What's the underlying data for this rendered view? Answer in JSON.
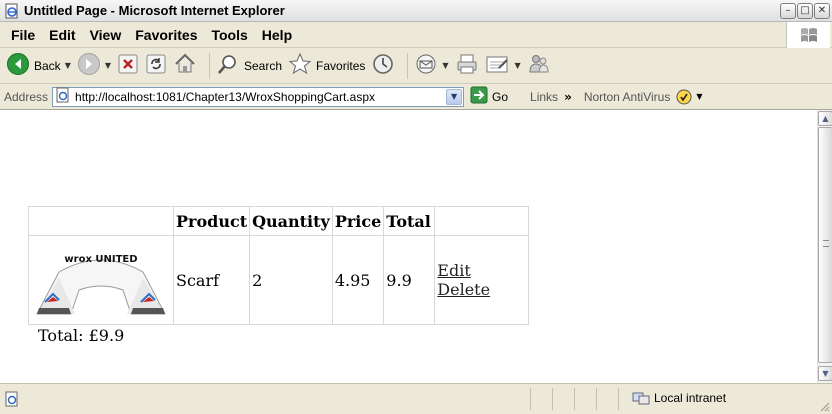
{
  "window": {
    "title": "Untitled Page - Microsoft Internet Explorer",
    "buttons": {
      "minimize": "–",
      "maximize": "□",
      "close": "✕"
    }
  },
  "menu": [
    "File",
    "Edit",
    "View",
    "Favorites",
    "Tools",
    "Help"
  ],
  "toolbar": {
    "back_label": "Back",
    "search_label": "Search",
    "favorites_label": "Favorites"
  },
  "address": {
    "label": "Address",
    "url": "http://localhost:1081/Chapter13/WroxShoppingCart.aspx",
    "go_label": "Go",
    "links_label": "Links",
    "norton_label": "Norton AntiVirus"
  },
  "cart": {
    "headers": [
      "Product",
      "Quantity",
      "Price",
      "Total"
    ],
    "rows": [
      {
        "product": "Scarf",
        "quantity": "2",
        "price": "4.95",
        "total": "9.9",
        "edit_label": "Edit",
        "delete_label": "Delete",
        "image_text": "wrox UNITED"
      }
    ],
    "grand_total": "Total: £9.9"
  },
  "status": {
    "zone": "Local intranet"
  },
  "icons": {
    "title": "ie-page-icon",
    "back": "back-arrow-icon",
    "forward": "forward-arrow-icon",
    "stop": "stop-icon",
    "refresh": "refresh-icon",
    "home": "home-icon",
    "search": "search-icon",
    "favorites": "favorites-star-icon",
    "history": "history-icon",
    "mail": "mail-icon",
    "print": "print-icon",
    "edit": "edit-icon",
    "messenger": "messenger-icon"
  }
}
